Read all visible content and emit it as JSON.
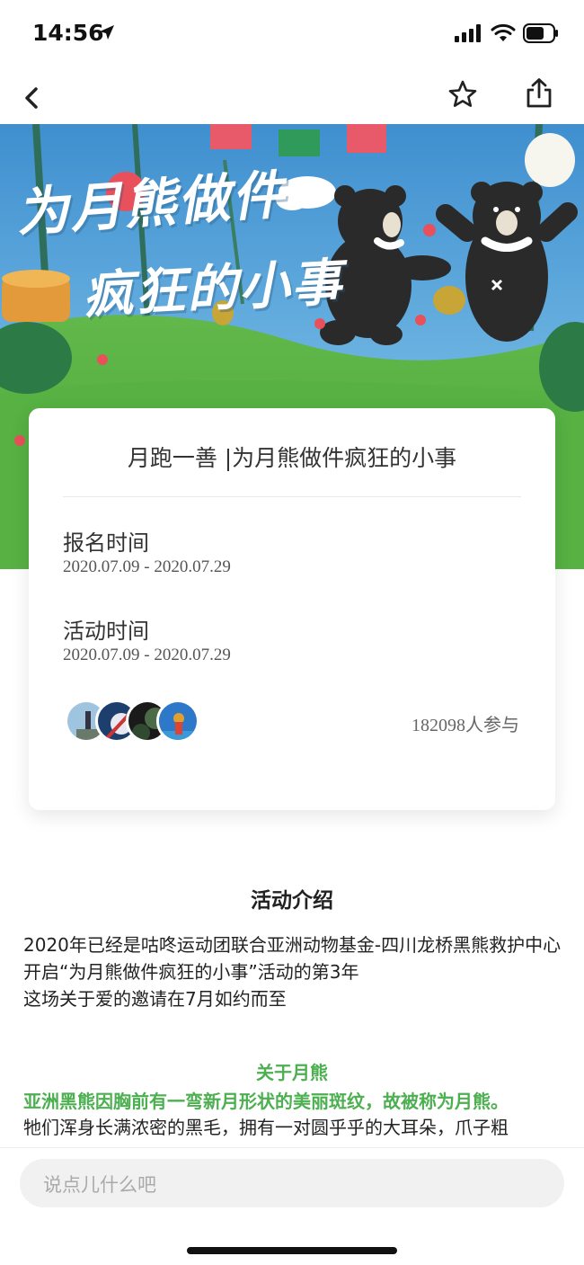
{
  "status_bar": {
    "time": "14:56"
  },
  "banner": {
    "title_line1": "为月熊做件",
    "title_line2": "疯狂的小事"
  },
  "card": {
    "title": "月跑一善 |为月熊做件疯狂的小事",
    "registration": {
      "label": "报名时间",
      "dates": "2020.07.09 - 2020.07.29"
    },
    "activity": {
      "label": "活动时间",
      "dates": "2020.07.09 - 2020.07.29"
    },
    "participants": {
      "count": "182098",
      "suffix": "人参与"
    }
  },
  "intro": {
    "heading": "活动介绍",
    "lines": [
      "2020年已经是咕咚运动团联合亚洲动物基金-四川龙桥黑熊救护中心",
      "开启“为月熊做件疯狂的小事”活动的第3年",
      "这场关于爱的邀请在7月如约而至"
    ],
    "about_heading": "关于月熊",
    "about_highlight": "亚洲黑熊因胸前有一弯新月形状的美丽斑纹，故被称为月熊。",
    "about_body": "牠们浑身长满浓密的黑毛，拥有一对圆乎乎的大耳朵，爪子粗"
  },
  "comment": {
    "placeholder": "说点儿什么吧"
  },
  "icons": {
    "back": "chevron-left-icon",
    "favorite": "star-icon",
    "share": "share-icon",
    "signal": "cellular-signal-icon",
    "wifi": "wifi-icon",
    "battery": "battery-icon",
    "location": "location-arrow-icon"
  },
  "colors": {
    "accent_green": "#4caf50",
    "banner_sky": "#4a9fd4",
    "grass": "#6cc04a"
  }
}
